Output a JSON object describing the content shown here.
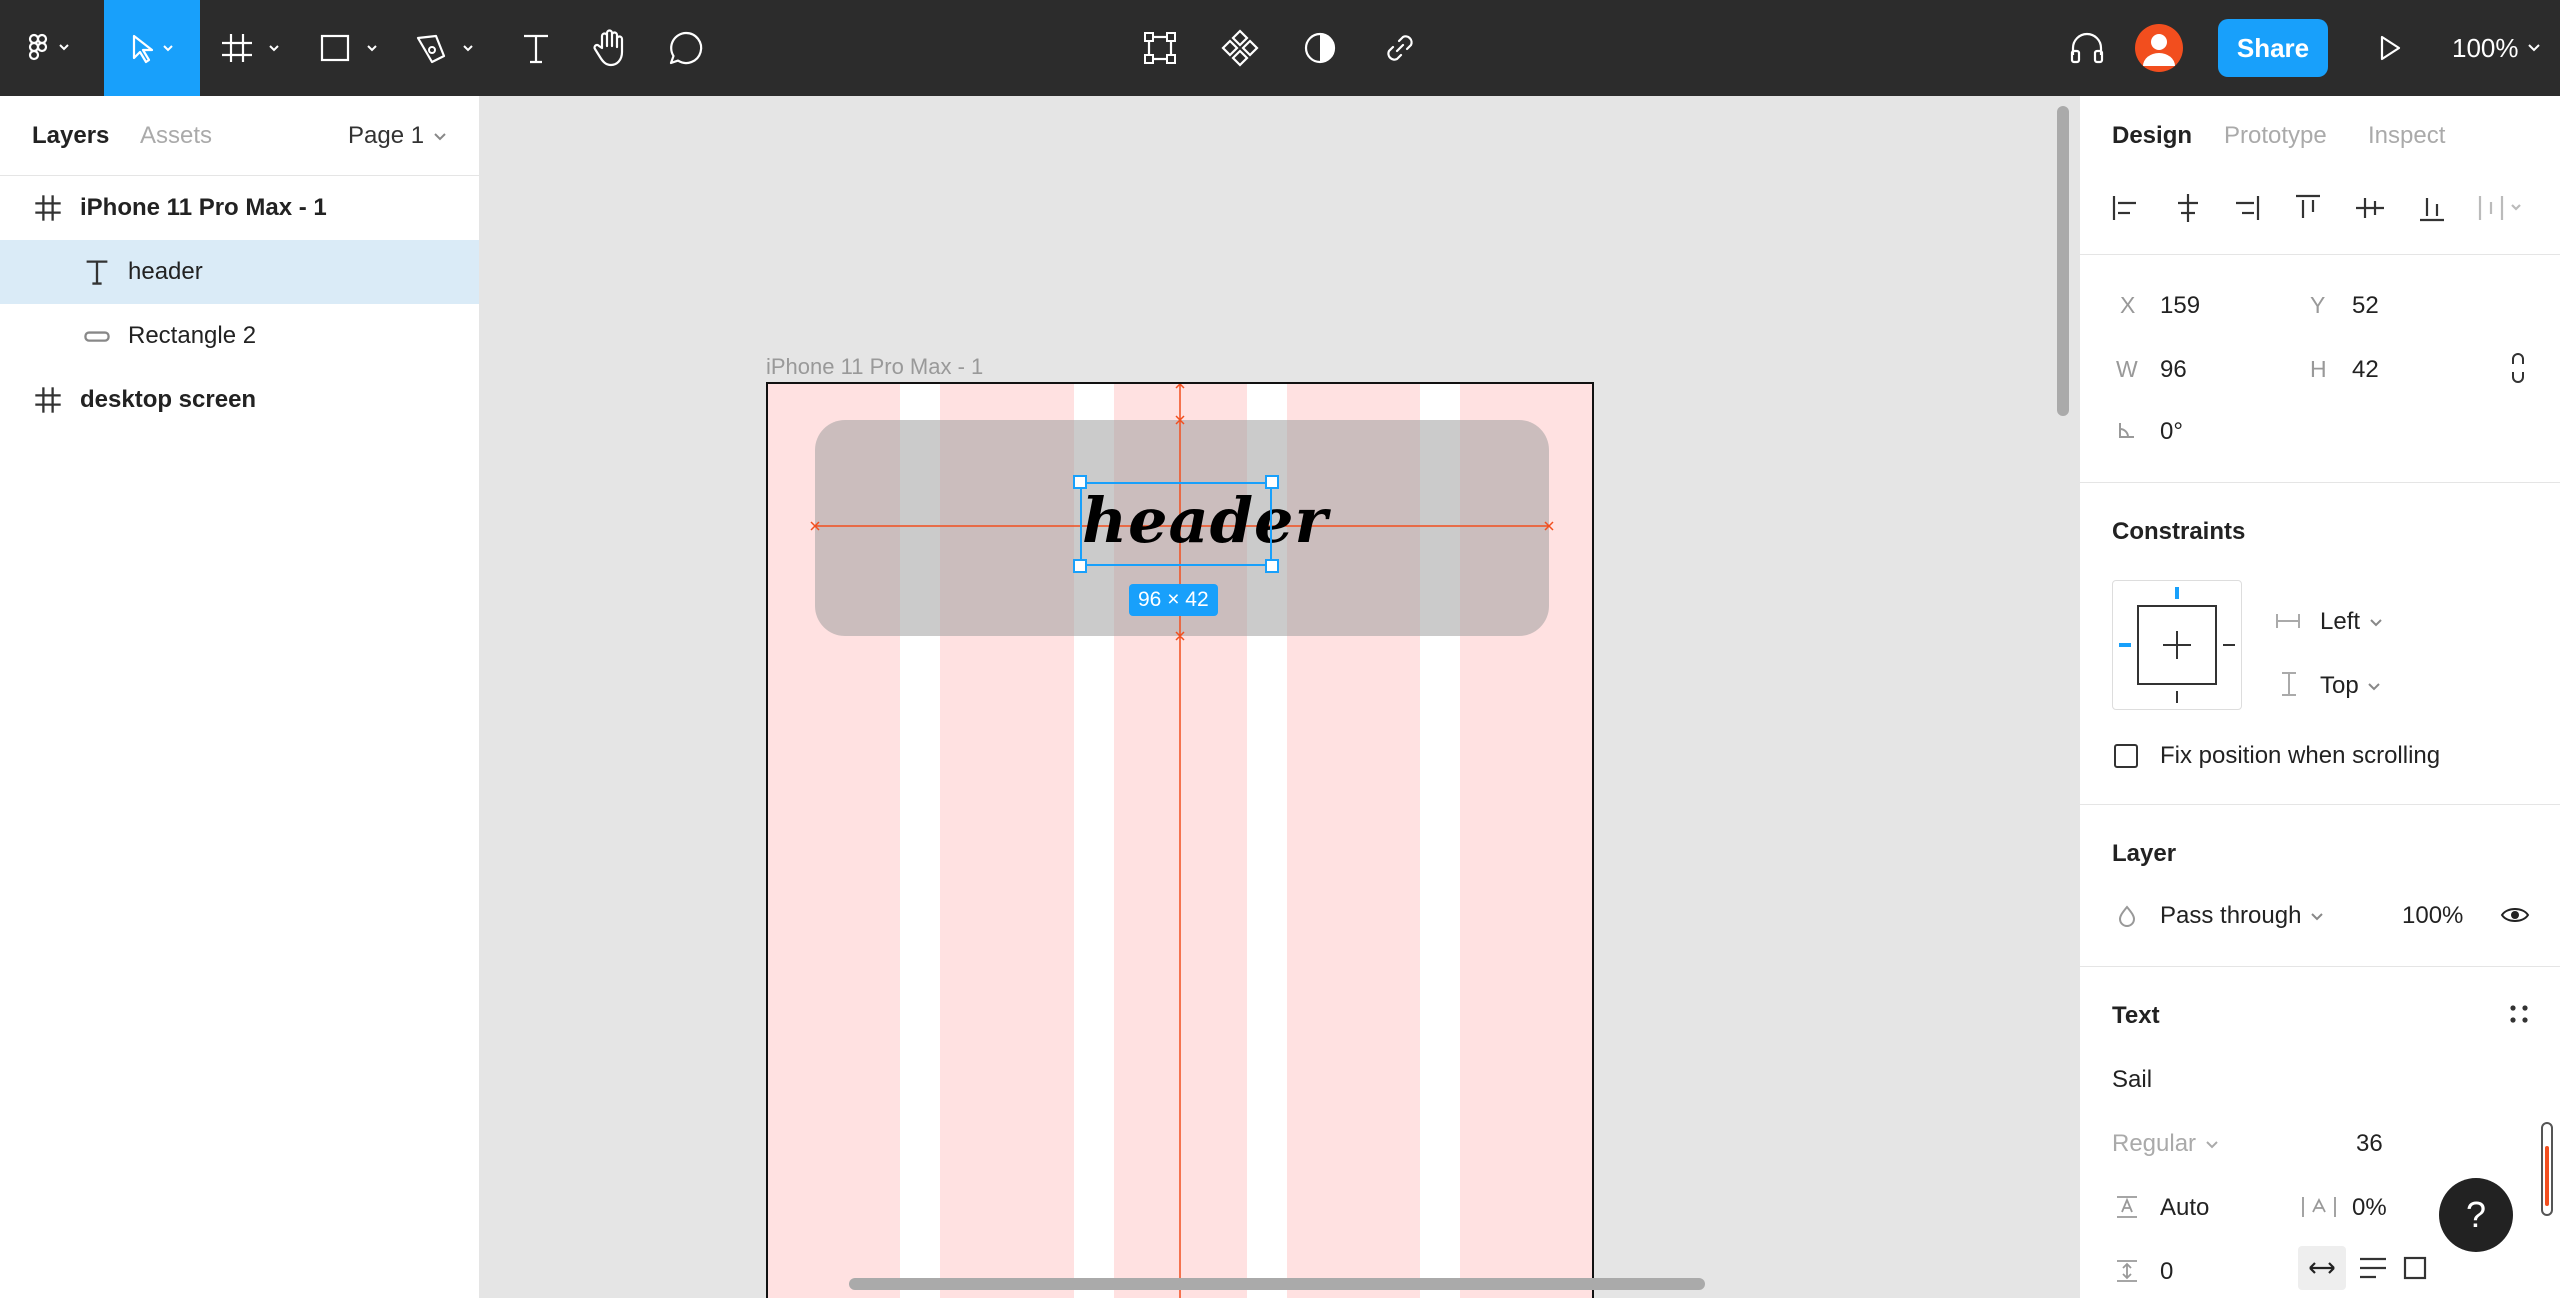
{
  "toolbar": {
    "share_label": "Share",
    "zoom_label": "100%"
  },
  "left_panel": {
    "tabs": [
      "Layers",
      "Assets"
    ],
    "page_label": "Page 1",
    "layers": [
      {
        "label": "iPhone 11 Pro Max - 1",
        "type": "frame"
      },
      {
        "label": "header",
        "type": "text"
      },
      {
        "label": "Rectangle 2",
        "type": "rectangle"
      },
      {
        "label": "desktop screen",
        "type": "frame"
      }
    ]
  },
  "canvas": {
    "frame_label": "iPhone 11 Pro Max - 1",
    "header_text": "header",
    "size_badge": "96 × 42"
  },
  "right_panel": {
    "tabs": [
      "Design",
      "Prototype",
      "Inspect"
    ],
    "position": {
      "x_label": "X",
      "x": "159",
      "y_label": "Y",
      "y": "52",
      "w_label": "W",
      "w": "96",
      "h_label": "H",
      "h": "42",
      "rotation": "0°"
    },
    "constraints": {
      "title": "Constraints",
      "horizontal": "Left",
      "vertical": "Top",
      "fix_position": "Fix position when scrolling"
    },
    "layer": {
      "title": "Layer",
      "blend": "Pass through",
      "opacity": "100%"
    },
    "text": {
      "title": "Text",
      "font": "Sail",
      "style": "Regular",
      "size": "36",
      "line_height": "Auto",
      "letter_spacing": "0%",
      "paragraph_spacing": "0"
    }
  },
  "help_label": "?",
  "colors": {
    "accent": "#18a0fb",
    "toolbar_bg": "#2c2c2c",
    "grid_column": "#ffe1e1",
    "guide": "#f24e1e"
  }
}
